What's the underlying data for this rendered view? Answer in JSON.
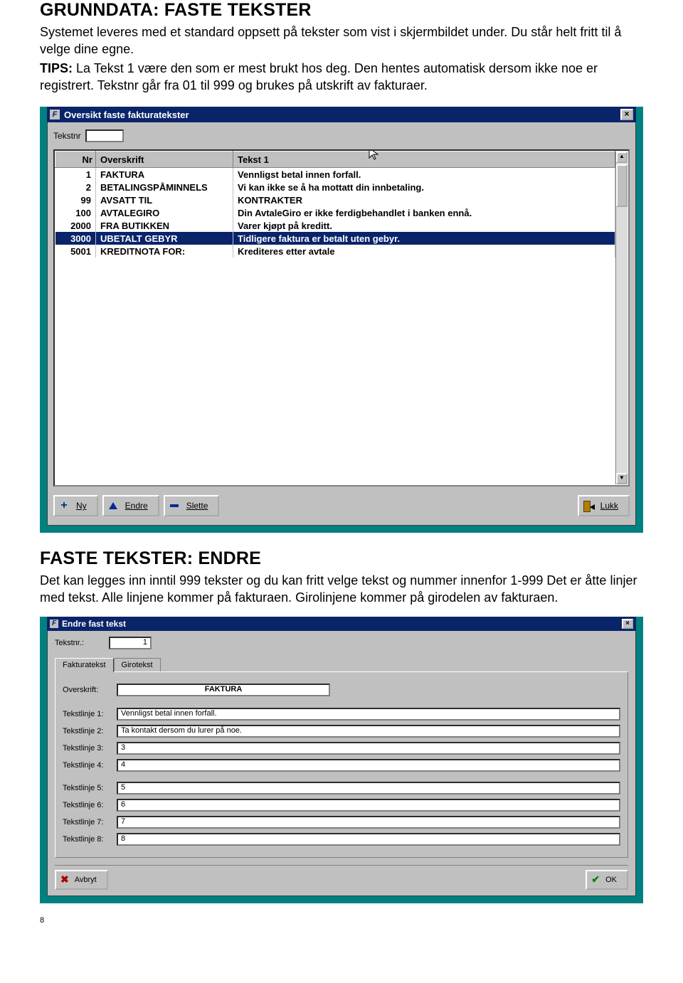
{
  "section1": {
    "title": "GRUNNDATA: FASTE TEKSTER",
    "p1": "Systemet leveres med et standard oppsett på tekster som vist i skjermbildet under. Du står helt fritt til å velge dine egne.",
    "p2a": "TIPS:",
    "p2b": " La Tekst 1 være den som er mest brukt hos deg. Den hentes automatisk dersom ikke noe er registrert. Tekstnr går fra 01 til 999 og  brukes på utskrift av fakturaer."
  },
  "win1": {
    "title": "Oversikt faste fakturatekster",
    "tekstnr_label": "Tekstnr",
    "headers": {
      "nr": "Nr",
      "overskrift": "Overskrift",
      "tekst1": "Tekst 1"
    },
    "rows": [
      {
        "nr": "1",
        "ov": "FAKTURA",
        "t": "Vennligst betal innen forfall."
      },
      {
        "nr": "2",
        "ov": "BETALINGSPÅMINNELS",
        "t": "Vi kan ikke se å ha mottatt din innbetaling."
      },
      {
        "nr": "99",
        "ov": "AVSATT TIL",
        "t": "KONTRAKTER"
      },
      {
        "nr": "100",
        "ov": "AVTALEGIRO",
        "t": "Din AvtaleGiro er ikke ferdigbehandlet i banken ennå."
      },
      {
        "nr": "2000",
        "ov": "FRA BUTIKKEN",
        "t": "Varer kjøpt på kreditt."
      },
      {
        "nr": "3000",
        "ov": "UBETALT GEBYR",
        "t": "Tidligere faktura er betalt uten gebyr."
      },
      {
        "nr": "5001",
        "ov": "KREDITNOTA FOR:",
        "t": "Krediteres etter avtale"
      }
    ],
    "selected_index": 5,
    "buttons": {
      "ny": "Ny",
      "endre": "Endre",
      "slette": "Slette",
      "lukk": "Lukk"
    }
  },
  "section2": {
    "title": "FASTE TEKSTER: ENDRE",
    "p": "Det kan legges inn inntil 999 tekster og du kan fritt velge tekst og nummer innenfor 1-999  Det er åtte linjer med tekst. Alle linjene kommer på fakturaen. Girolinjene kommer på girodelen av fakturaen."
  },
  "win2": {
    "title": "Endre fast tekst",
    "tekstnr_label": "Tekstnr.:",
    "tekstnr_value": "1",
    "tabs": {
      "faktura": "Fakturatekst",
      "giro": "Girotekst"
    },
    "overskrift_label": "Overskrift:",
    "overskrift_value": "FAKTURA",
    "lines": [
      {
        "label": "Tekstlinje 1:",
        "value": "Vennligst betal innen forfall."
      },
      {
        "label": "Tekstlinje 2:",
        "value": "Ta kontakt dersom du lurer på noe."
      },
      {
        "label": "Tekstlinje 3:",
        "value": "3"
      },
      {
        "label": "Tekstlinje 4:",
        "value": "4"
      },
      {
        "label": "Tekstlinje 5:",
        "value": "5"
      },
      {
        "label": "Tekstlinje 6:",
        "value": "6"
      },
      {
        "label": "Tekstlinje 7:",
        "value": "7"
      },
      {
        "label": "Tekstlinje 8:",
        "value": "8"
      }
    ],
    "buttons": {
      "avbryt": "Avbryt",
      "ok": "OK"
    }
  },
  "page_number": "8"
}
